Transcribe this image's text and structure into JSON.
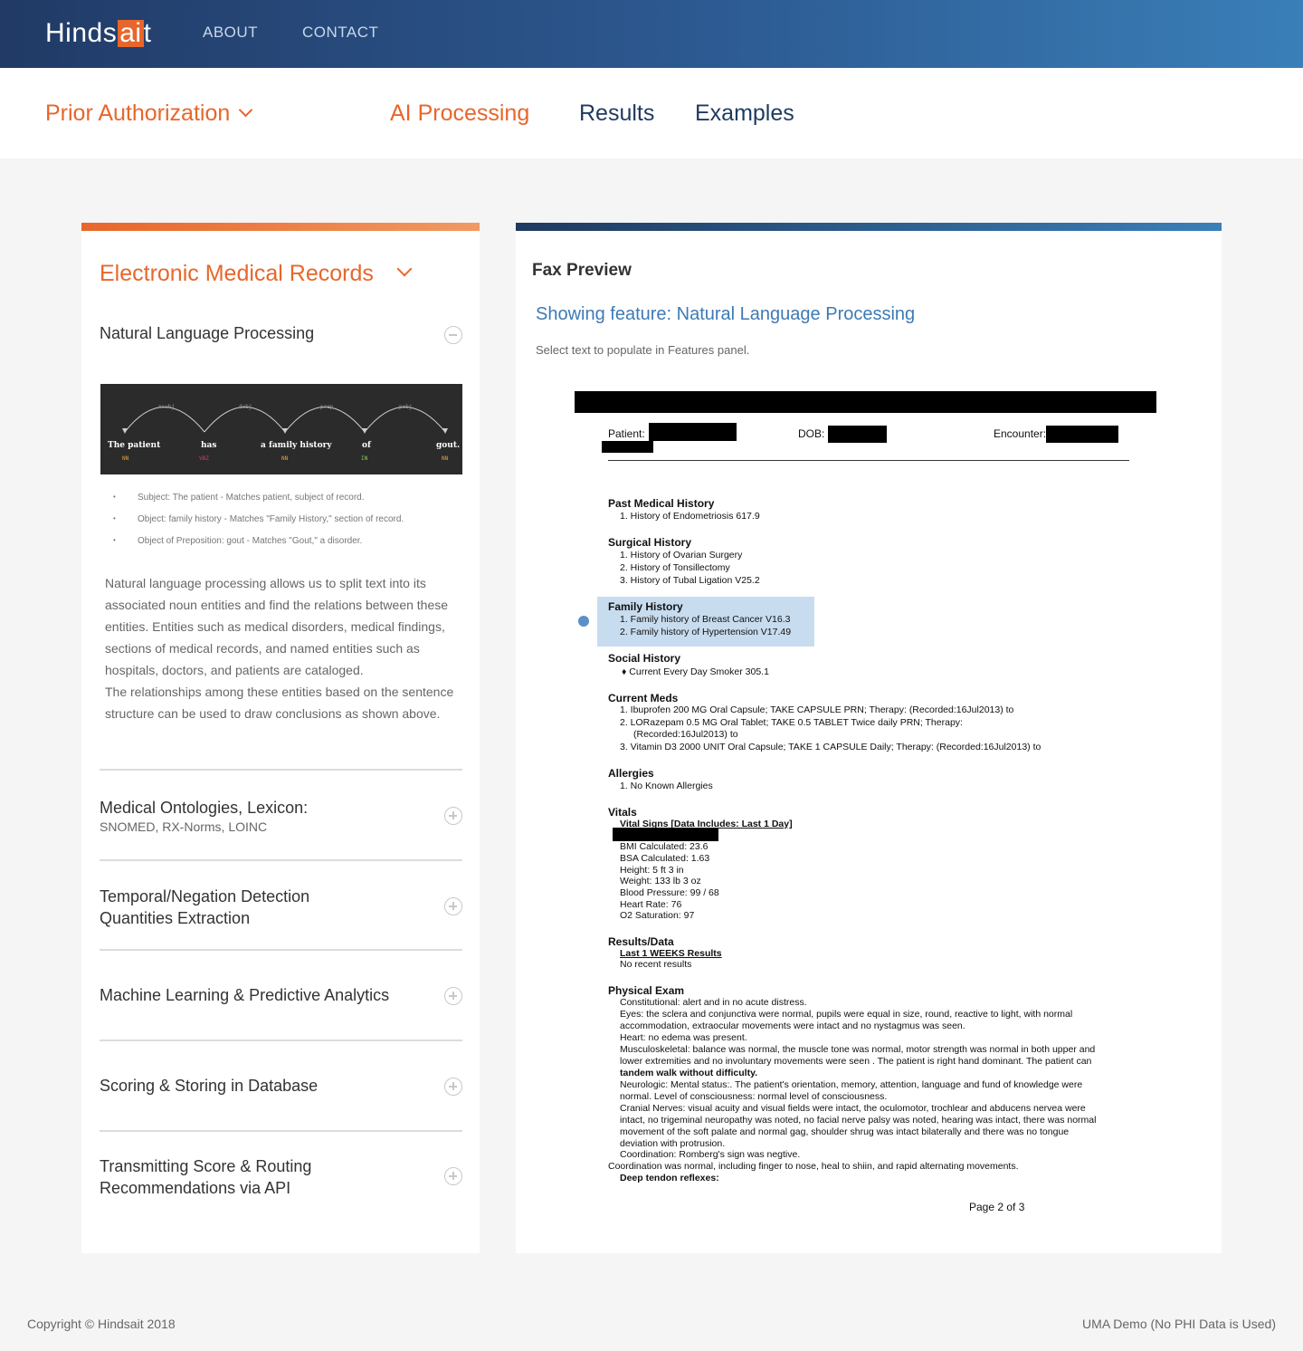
{
  "header": {
    "logo_prefix": "Hinds",
    "logo_highlight": "ai",
    "logo_suffix": "t",
    "nav": [
      "ABOUT",
      "CONTACT"
    ]
  },
  "subnav": {
    "product": "Prior Authorization",
    "tabs": [
      "AI Processing",
      "Results",
      "Examples"
    ],
    "active_tab": "AI Processing"
  },
  "left_panel": {
    "section_title": "Electronic Medical Records",
    "nlp": {
      "title": "Natural Language Processing",
      "diagram": {
        "words": [
          "The patient",
          "has",
          "a family history",
          "of",
          "gout."
        ],
        "tags": [
          "NN",
          "VBZ",
          "NN",
          "IN",
          "NN"
        ],
        "arcs": [
          "nsubj",
          "dobj",
          "prep",
          "pobj"
        ]
      },
      "bullets": [
        "Subject: The patient - Matches patient, subject of record.",
        "Object: family history - Matches \"Family History,\" section of record.",
        "Object of Preposition: gout - Matches \"Gout,\" a disorder."
      ],
      "description_1": "Natural language processing allows us to split text into its associated noun entities and find the relations between these entities. Entities such as medical disorders, medical findings, sections of medical records, and named entities such as hospitals, doctors, and patients are cataloged.",
      "description_2": "The relationships among these entities based on the sentence structure can be used to draw conclusions as shown above."
    },
    "accordion": [
      {
        "title": "Medical Ontologies, Lexicon:",
        "subtitle": "SNOMED, RX-Norms, LOINC"
      },
      {
        "title": "Temporal/Negation Detection",
        "title2": "Quantities Extraction"
      },
      {
        "title": "Machine Learning & Predictive Analytics"
      },
      {
        "title": "Scoring & Storing in Database"
      },
      {
        "title": "Transmitting Score & Routing",
        "title2": "Recommendations via API"
      }
    ]
  },
  "right_panel": {
    "title": "Fax Preview",
    "showing": "Showing feature: Natural Language Processing",
    "hint": "Select text to populate in Features panel.",
    "fax": {
      "patient_label": "Patient:",
      "dob_label": "DOB:",
      "encounter_label": "Encounter:",
      "sections": {
        "past_medical": {
          "head": "Past Medical History",
          "lines": [
            "1. History of  Endometriosis 617.9"
          ]
        },
        "surgical": {
          "head": "Surgical History",
          "lines": [
            "1. History of  Ovarian Surgery",
            "2. History of  Tonsillectomy",
            "3. History of  Tubal Ligation V25.2"
          ]
        },
        "family": {
          "head": "Family History",
          "lines": [
            "1. Family history of  Breast Cancer V16.3",
            "2. Family history of  Hypertension V17.49"
          ]
        },
        "social": {
          "head": "Social History",
          "lines": [
            "♦ Current Every Day Smoker 305.1"
          ]
        },
        "meds": {
          "head": "Current Meds",
          "lines": [
            "1. Ibuprofen 200 MG Oral Capsule; TAKE CAPSULE  PRN; Therapy: (Recorded:16Jul2013) to",
            "2. LORazepam 0.5 MG Oral Tablet; TAKE 0.5 TABLET Twice daily PRN; Therapy:",
            "(Recorded:16Jul2013) to",
            "3. Vitamin D3 2000 UNIT Oral Capsule; TAKE 1 CAPSULE Daily; Therapy: (Recorded:16Jul2013) to"
          ]
        },
        "allergies": {
          "head": "Allergies",
          "lines": [
            "1. No Known Allergies"
          ]
        },
        "vitals": {
          "head": "Vitals",
          "sub": "Vital Signs [Data Includes: Last 1 Day]",
          "lines": [
            "BMI Calculated: 23.6",
            "BSA Calculated: 1.63",
            "Height: 5 ft 3 in",
            "Weight: 133 lb 3 oz",
            "Blood Pressure: 99 / 68",
            "Heart Rate: 76",
            "O2 Saturation: 97"
          ]
        },
        "results": {
          "head": "Results/Data",
          "sub": "Last 1 WEEKS Results",
          "lines": [
            "No recent results"
          ]
        },
        "physical": {
          "head": "Physical Exam",
          "lines": [
            "Constitutional: alert and in no acute distress.",
            "Eyes: the sclera and conjunctiva were normal, pupils were equal in size, round, reactive to light, with normal",
            "accommodation, extraocular movements were intact and no nystagmus was seen.",
            "Heart: no edema was present.",
            "Musculoskeletal: balance was normal, the muscle tone was normal, motor strength was normal in both upper and",
            "lower extremities and no involuntary movements were seen . The patient is right hand dominant. The patient can",
            "tandem walk without difficulty.",
            "Neurologic: Mental status:. The patient's orientation, memory, attention, language and fund of knowledge were",
            "normal. Level of consciousness: normal level of consciousness.",
            "Cranial Nerves: visual acuity and visual fields were intact, the oculomotor, trochlear and abducens nervea were",
            "intact, no trigeminal neuropathy was noted, no facial nerve palsy was noted, hearing was intact, there was normal",
            "movement of the soft palate and normal gag, shoulder shrug was intact bilaterally and there was no tongue",
            "deviation with protrusion.",
            "Coordination: Romberg's sign was negtive.",
            "Coordination was normal, including finger to nose, heal to shiin, and rapid alternating movements.",
            "Deep tendon reflexes:"
          ]
        }
      },
      "page": "Page 2 of 3"
    }
  },
  "footer": {
    "copyright": "Copyright © Hindsait 2018",
    "note": "UMA Demo (No PHI Data is Used)"
  },
  "colors": {
    "accent_orange": "#e8662b",
    "navy": "#1f3a5f",
    "link_blue": "#3d7ab5",
    "highlight": "#c8dcef"
  }
}
